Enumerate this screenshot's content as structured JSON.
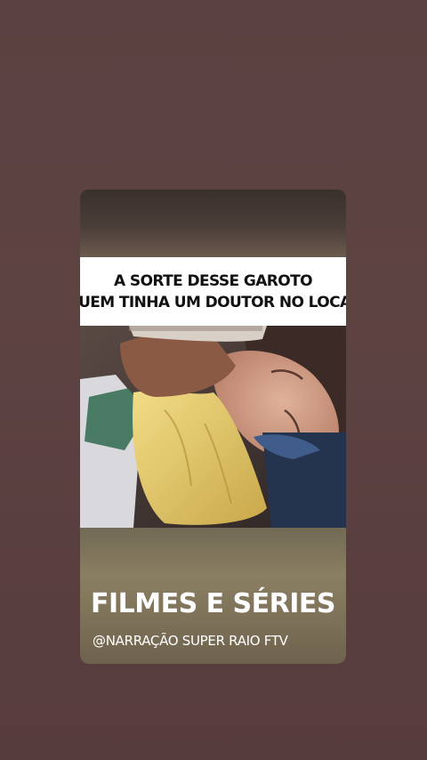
{
  "story": {
    "caption_line1": "A SORTE DESSE GAROTO",
    "caption_line2": "QUEM TINHA UM DOUTOR NO LOCAL",
    "brand_title": "FILMES E SÉRIES",
    "handle": "@NARRAÇÃO SUPER RAIO FTV"
  },
  "colors": {
    "page_background": "#5b4141",
    "caption_background": "#ffffff",
    "caption_text": "#111111",
    "brand_text": "#ffffff"
  }
}
